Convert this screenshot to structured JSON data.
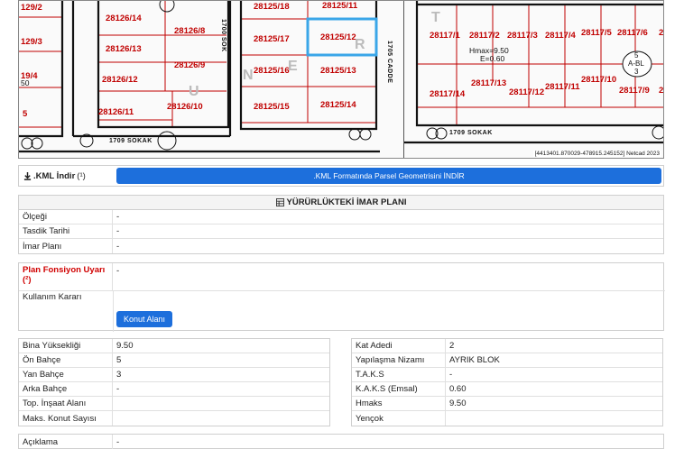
{
  "map": {
    "left_labels": [
      "129/2",
      "129/3",
      "19/4",
      "50",
      "5"
    ],
    "parcels": [
      "28126/14",
      "28126/8",
      "28126/13",
      "28126/9",
      "28126/12",
      "28126/11",
      "28126/10",
      "28125/18",
      "28125/11",
      "28125/17",
      "28125/12",
      "28125/16",
      "28125/13",
      "28125/15",
      "28125/14",
      "28117/1",
      "28117/2",
      "28117/3",
      "28117/4",
      "28117/5",
      "28117/6",
      "2811",
      "28117/13",
      "28117/14",
      "28117/12",
      "28117/11",
      "28117/10",
      "28117/9",
      "2811"
    ],
    "street_bottom_left": "1709 SOKAK",
    "street_bottom_right": "1709 SOKAK",
    "street_vertical_left": "1700 SOK",
    "street_vertical_mid": "1705 CADDE",
    "hmax_note": "Hmax=9.50",
    "e_note": "E=0.60",
    "zone_code": "5",
    "zone_type": "A-BL",
    "zone_floors": "3",
    "zone_letters": [
      "R",
      "E",
      "T",
      "N",
      "R",
      "U",
      "R"
    ],
    "coordinate_readout": "[4413401.870029-478915.245152] Netcad 2023"
  },
  "kml": {
    "label": ".KML İndir",
    "note_marker": "(¹)",
    "button_label": ".KML Formatında Parsel Geometrisini İNDİR"
  },
  "imar": {
    "title": "YÜRÜRLÜKTEKİ İMAR PLANI",
    "rows": [
      {
        "label": "Ölçeği",
        "value": "-"
      },
      {
        "label": "Tasdik Tarihi",
        "value": "-"
      },
      {
        "label": "İmar Planı",
        "value": "-"
      }
    ]
  },
  "fonksiyon": {
    "warning_label": "Plan Fonsiyon Uyarı",
    "warning_marker": "(²)",
    "warning_value": "-",
    "usage_label": "Kullanım Kararı",
    "usage_button": "Konut Alanı"
  },
  "left_table": [
    {
      "label": "Bina Yüksekliği",
      "value": "9.50"
    },
    {
      "label": "Ön Bahçe",
      "value": "5"
    },
    {
      "label": "Yan Bahçe",
      "value": "3"
    },
    {
      "label": "Arka Bahçe",
      "value": "-"
    },
    {
      "label": "Top. İnşaat Alanı",
      "value": ""
    },
    {
      "label": "Maks. Konut Sayısı",
      "value": ""
    }
  ],
  "right_table": [
    {
      "label": "Kat Adedi",
      "value": "2"
    },
    {
      "label": "Yapılaşma Nizamı",
      "value": "AYRIK BLOK"
    },
    {
      "label": "T.A.K.S",
      "value": "-"
    },
    {
      "label": "K.A.K.S (Emsal)",
      "value": "0.60"
    },
    {
      "label": "Hmaks",
      "value": "9.50"
    },
    {
      "label": "Yençok",
      "value": ""
    }
  ],
  "aciklama": {
    "label": "Açıklama",
    "value": "-"
  },
  "colors": {
    "accent": "#1d6fdc",
    "parcel": "#c00000",
    "warning": "#d00000",
    "selection": "#3aa6e8"
  }
}
